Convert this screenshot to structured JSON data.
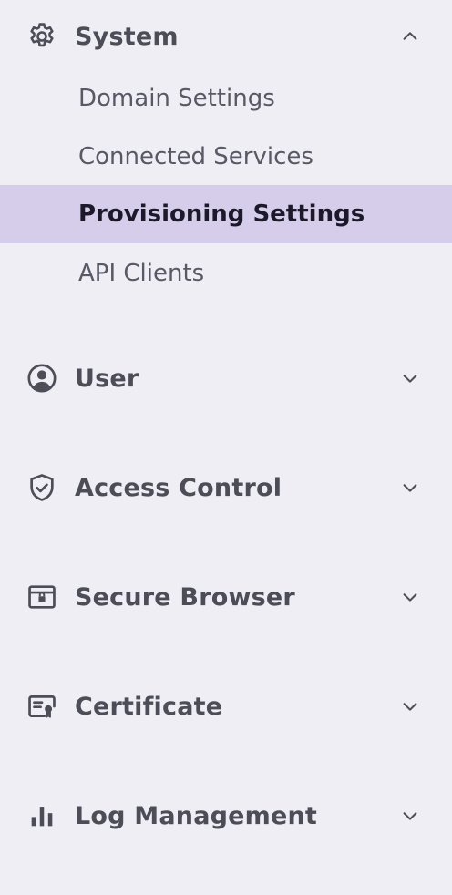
{
  "sections": [
    {
      "label": "System",
      "icon": "gear-icon",
      "expanded": true,
      "items": [
        {
          "label": "Domain Settings",
          "active": false
        },
        {
          "label": "Connected Services",
          "active": false
        },
        {
          "label": "Provisioning Settings",
          "active": true
        },
        {
          "label": "API Clients",
          "active": false
        }
      ]
    },
    {
      "label": "User",
      "icon": "user-circle-icon",
      "expanded": false
    },
    {
      "label": "Access Control",
      "icon": "shield-check-icon",
      "expanded": false
    },
    {
      "label": "Secure Browser",
      "icon": "browser-window-icon",
      "expanded": false
    },
    {
      "label": "Certificate",
      "icon": "certificate-icon",
      "expanded": false
    },
    {
      "label": "Log Management",
      "icon": "bar-chart-icon",
      "expanded": false
    }
  ],
  "colors": {
    "background": "#efeef4",
    "active_background": "#d6cdea",
    "text": "#4d4d58",
    "active_text": "#1c1a2a"
  }
}
